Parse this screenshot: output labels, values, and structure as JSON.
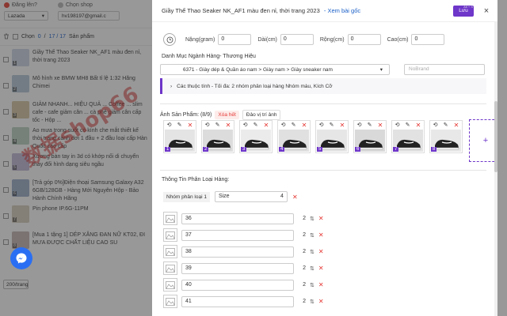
{
  "left_panel": {
    "step1_label": "Đăng lên?",
    "step2_label": "Chọn shop",
    "platform": "Lazada",
    "shop_value": "hv198197@gmail.c",
    "choose_prefix": "Chọn",
    "choose_selected": "0",
    "choose_total": "17 / 17",
    "choose_suffix": "Sản phẩm",
    "products": [
      {
        "num": "1",
        "title": "Giầy Thể Thao Seaker NK_AF1 màu đen nỉ, thời trang 2023",
        "color": "#cfd7e6"
      },
      {
        "num": "2",
        "title": "Mô hình xe BMW MH8 Bất tỉ lệ 1:32 Hãng Chimei",
        "color": "#b8c9d8"
      },
      {
        "num": "3",
        "title": "GIẢM NHANH... HIỆU QUẢ ... Coffee ... slim cafe - cafe giảm cân ... cà phê giảm cân cấp tốc - Hộp ...",
        "color": "#d8c7a8"
      },
      {
        "num": "4",
        "title": "Ao mưa trong suốt có kính che mắt thiết kế thời trang cánh dơi 1 đầu + 2 đầu loại cấp Hàn Quốc cao cấp",
        "color": "#bcd3c4"
      },
      {
        "num": "5",
        "title": "Xương bàn tay in 3d có khớp nối di chuyển thay đổi hình dạng siêu ngầu",
        "color": "#c4bcd8"
      },
      {
        "num": "6",
        "title": "[Trả góp 0%]Điện thoại Samsung Galaxy A32 6GB/128GB - Hàng Mới Nguyên Hộp - Bảo Hành Chính Hãng",
        "color": "#9fb0c9"
      },
      {
        "num": "7",
        "title": "Pin phone IP.6G-11PM",
        "color": "#d9d0c0"
      },
      {
        "num": "8",
        "title": "[Mua 1 tặng 1] DÉP XĂNG ĐAN NỮ KT02, ĐI MƯA ĐƯỢC CHẤT LIỆU CAO SU",
        "color": "#c8b6b6"
      }
    ],
    "page_size": "200/trang",
    "watermark": "数据shop66"
  },
  "modal": {
    "title": "Giầy Thể Thao Seaker NK_AF1 màu đen nỉ, thời trang 2023",
    "view_original": "- Xem bài gốc",
    "save_label": "Lưu",
    "save_hint": "Alt + S",
    "close_label": "×",
    "weight_label": "Nặng(gram)",
    "weight_value": "0",
    "length_label": "Dài(cm)",
    "length_value": "0",
    "width_label": "Rộng(cm)",
    "width_value": "0",
    "height_label": "Cao(cm)",
    "height_value": "0",
    "category_section": "Danh Mục Ngành Hàng- Thương Hiệu",
    "category_path": "6371 - Giày dép & Quần áo nam > Giày nam > Giày sneaker nam",
    "brand_placeholder": "NoBrand",
    "attributes_text": "Các thuộc tính - Tối đa: 2 nhóm phân loại hàng Nhóm màu, Kích Cỡ",
    "images_label": "Ảnh Sản Phẩm: (8/9)",
    "delete_all_label": "Xóa hết",
    "reverse_label": "Đảo vị trí ảnh",
    "images": [
      {
        "num": "1",
        "color": "#e4e4e4"
      },
      {
        "num": "2",
        "color": "#dcdcdc"
      },
      {
        "num": "3",
        "color": "#ebebeb"
      },
      {
        "num": "4",
        "color": "#e0e0e0"
      },
      {
        "num": "5",
        "color": "#e6e6e6"
      },
      {
        "num": "6",
        "color": "#d9d9d9"
      },
      {
        "num": "7",
        "color": "#e2e2e2"
      },
      {
        "num": "8",
        "color": "#e8e8e8"
      }
    ],
    "add_image_label": "+",
    "variation_section": "Thông Tin Phân Loại Hàng:",
    "group_label": "Nhóm phân loại 1",
    "group_name": "Size",
    "group_count": "4",
    "variations": [
      {
        "value": "36",
        "idx": "2"
      },
      {
        "value": "37",
        "idx": "2"
      },
      {
        "value": "38",
        "idx": "2"
      },
      {
        "value": "39",
        "idx": "2"
      },
      {
        "value": "40",
        "idx": "2"
      },
      {
        "value": "41",
        "idx": "2"
      }
    ]
  },
  "colors": {
    "accent": "#6e36c9",
    "danger": "#e53935",
    "link": "#1a5fc7",
    "messenger": "#2a6ff3"
  }
}
